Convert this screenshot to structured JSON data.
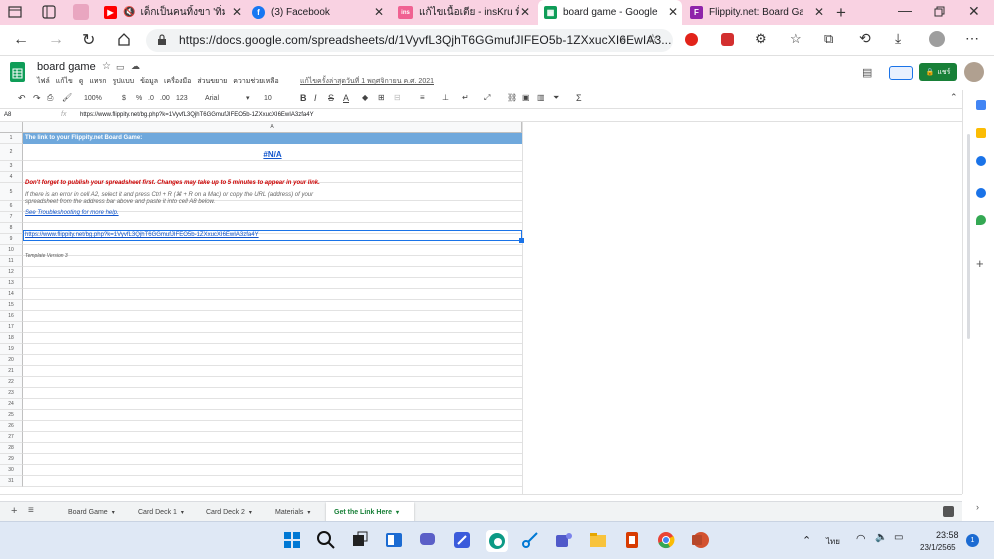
{
  "browser": {
    "tabs": [
      {
        "title": "เด็กเป็นคนทิ้งขา 'ทิ่มม",
        "favicon": "youtube",
        "color": "#ff0000",
        "muted": true
      },
      {
        "title": "(3) Facebook",
        "favicon": "facebook",
        "color": "#1877f2"
      },
      {
        "title": "แก้ไขเนื้อเตีย - insKru พื้นที่",
        "favicon": "inskru",
        "color": "#f06292"
      },
      {
        "title": "board game - Google",
        "favicon": "sheets",
        "color": "#0f9d58",
        "active": true
      },
      {
        "title": "Flippity.net: Board Gam",
        "favicon": "flippity",
        "color": "#8e24aa"
      }
    ],
    "url": "https://docs.google.com/spreadsheets/d/1VyvfL3QjhT6GGmufJIFEO5b-1ZXxucXI6EwIA3..."
  },
  "doc": {
    "title": "board game",
    "menus": [
      "ไฟล์",
      "แก้ไข",
      "ดู",
      "แทรก",
      "รูปแบบ",
      "ข้อมูล",
      "เครื่องมือ",
      "ส่วนขยาย",
      "ความช่วยเหลือ"
    ],
    "last_edit": "แก้ไขครั้งล่าสุดวันที่ 1 พฤศจิกายน ค.ศ. 2021",
    "share_label": "แชร์"
  },
  "toolbar": {
    "zoom": "100%",
    "currency": "$",
    "percent": "%",
    "dec_decrease": ".0",
    "dec_increase": ".00",
    "format_more": "123",
    "font": "Arial",
    "font_size": "10"
  },
  "formula": {
    "cell_ref": "A8",
    "fx": "fx",
    "content": "https://www.flippity.net/bg.php?k=1VyvfL3QjhT6GGmufJIFEO5b-1ZXxucXI6EwIA3zfa4Y"
  },
  "grid": {
    "column_header": "A",
    "row_count": 31,
    "cells": {
      "a1": "The link to your Flippity.net Board Game:",
      "a2": "#N/A",
      "a4": "Don't forget to publish your spreadsheet first. Changes may take up to 5 minutes to appear in your link.",
      "a5_line1": "If there is an error in cell A2, select it and press Ctrl + R (⌘ + R on a Mac) or copy the URL (address) of your",
      "a5_line2": "spreadsheet from the address bar above and paste it into cell A8 below.",
      "a6": "See Troubleshooting for more help.",
      "a8": "https://www.flippity.net/bg.php?k=1VyvfL3QjhT6GGmufJIFEO5b-1ZXxucXI6EwIA3zfa4Y",
      "a10": "Template Version 3"
    }
  },
  "sheets": {
    "tabs": [
      "Board Game",
      "Card Deck 1",
      "Card Deck 2",
      "Materials",
      "Get the Link Here"
    ],
    "active": "Get the Link Here"
  },
  "taskbar": {
    "language": "ไทย",
    "time": "23:58",
    "date": "23/1/2565",
    "notification_count": "1"
  },
  "colors": {
    "tab_strip": "#f9d2e2",
    "header_blue": "#6fa8dc",
    "warning_red": "#cc0000",
    "link_blue": "#1155cc",
    "sheets_green": "#188038"
  }
}
